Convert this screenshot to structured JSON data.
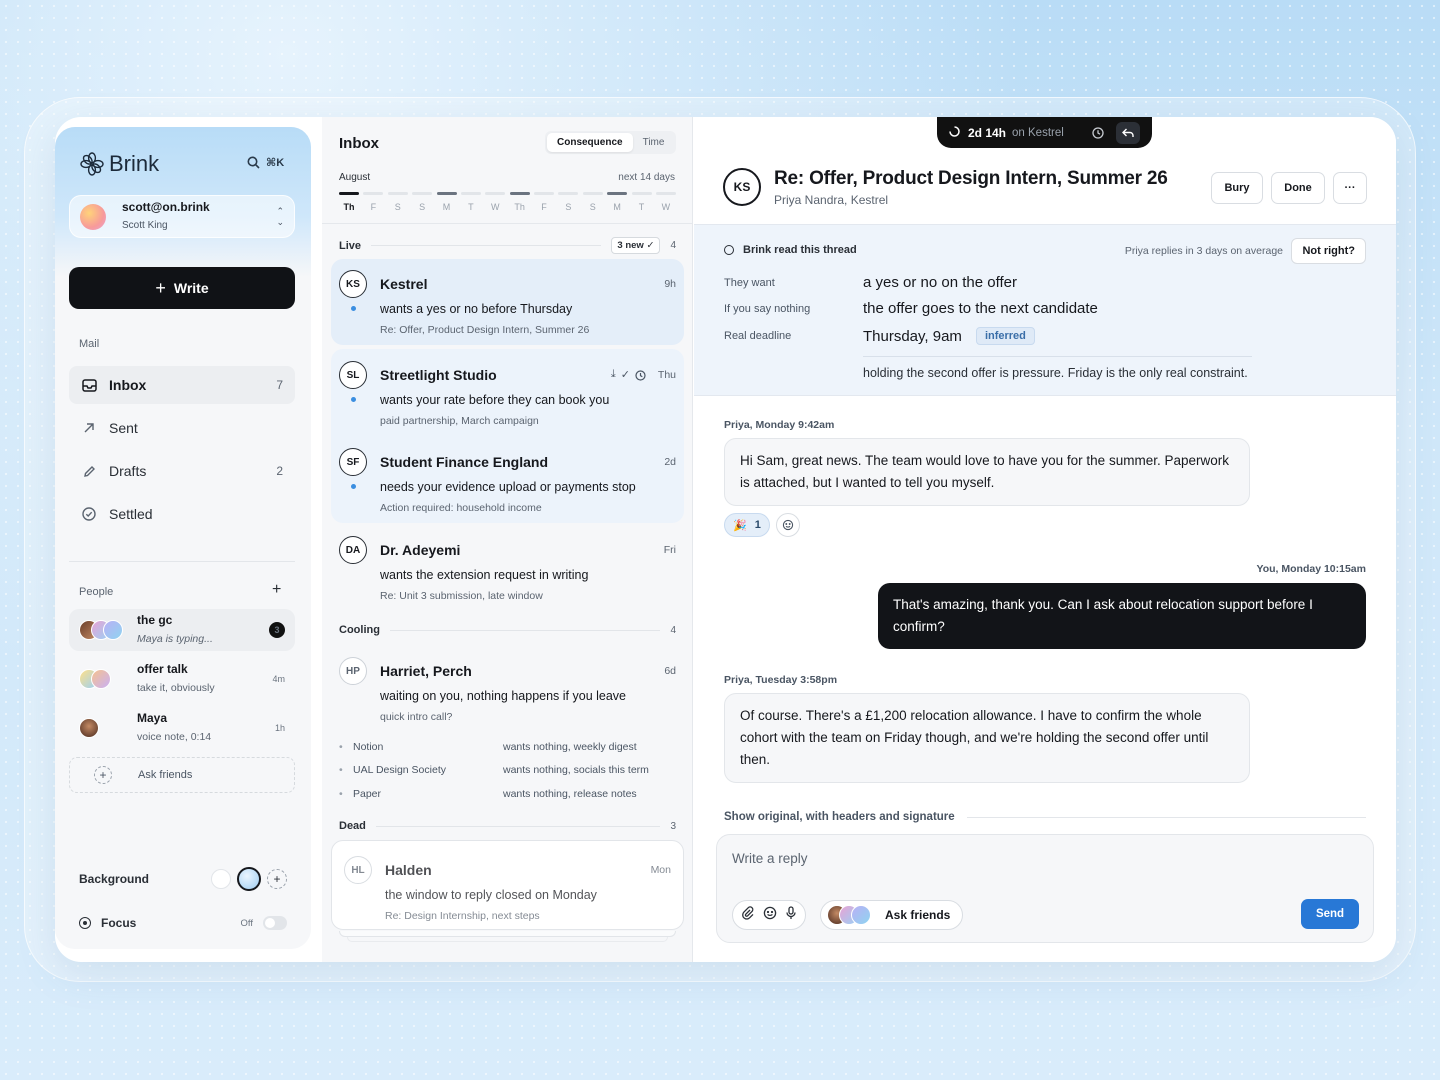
{
  "brand": {
    "name": "Brink",
    "search_shortcut": "⌘K"
  },
  "account": {
    "email": "scott@on.brink",
    "name": "Scott King"
  },
  "write_label": "Write",
  "mail_section": "Mail",
  "nav": [
    {
      "label": "Inbox",
      "count": "7"
    },
    {
      "label": "Sent",
      "count": ""
    },
    {
      "label": "Drafts",
      "count": "2"
    },
    {
      "label": "Settled",
      "count": ""
    }
  ],
  "people_section": "People",
  "people": [
    {
      "name": "the gc",
      "status": "Maya is typing...",
      "badge": "3"
    },
    {
      "name": "offer talk",
      "status": "take it, obviously",
      "time": "4m"
    },
    {
      "name": "Maya",
      "status": "voice note, 0:14",
      "time": "1h"
    }
  ],
  "ask_friends": "Ask friends",
  "background_label": "Background",
  "focus": {
    "label": "Focus",
    "state": "Off"
  },
  "inbox": {
    "title": "Inbox",
    "sort_options": [
      "Consequence",
      "Time"
    ],
    "sort_selected": "Consequence",
    "month": "August",
    "range": "next 14 days",
    "days": [
      "Th",
      "F",
      "S",
      "S",
      "M",
      "T",
      "W",
      "Th",
      "F",
      "S",
      "S",
      "M",
      "T",
      "W"
    ]
  },
  "groups": {
    "live": {
      "label": "Live",
      "new_badge": "3 new",
      "count": "4"
    },
    "cooling": {
      "label": "Cooling",
      "count": "4"
    },
    "dead": {
      "label": "Dead",
      "count": "3"
    }
  },
  "messages": [
    {
      "mono": "KS",
      "from": "Kestrel",
      "time": "9h",
      "summary": "wants a yes or no before Thursday",
      "subject": "Re: Offer, Product Design Intern, Summer 26"
    },
    {
      "mono": "SL",
      "from": "Streetlight Studio",
      "time": "Thu",
      "summary": "wants your rate before they can book you",
      "subject": "paid partnership, March campaign"
    },
    {
      "mono": "SF",
      "from": "Student Finance England",
      "time": "2d",
      "summary": "needs your evidence upload or payments stop",
      "subject": "Action required: household income"
    },
    {
      "mono": "DA",
      "from": "Dr. Adeyemi",
      "time": "Fri",
      "summary": "wants the extension request in writing",
      "subject": "Re: Unit 3 submission, late window"
    },
    {
      "mono": "HP",
      "from": "Harriet, Perch",
      "time": "6d",
      "summary": "waiting on you, nothing happens if you leave",
      "subject": "quick intro call?"
    },
    {
      "mono": "HL",
      "from": "Halden",
      "time": "Mon",
      "summary": "the window to reply closed on Monday",
      "subject": "Re: Design Internship, next steps"
    }
  ],
  "low_items": [
    {
      "name": "Notion",
      "note": "wants nothing, weekly digest"
    },
    {
      "name": "UAL Design Society",
      "note": "wants nothing, socials this term"
    },
    {
      "name": "Paper",
      "note": "wants nothing, release notes"
    }
  ],
  "timer": {
    "value": "2d 14h",
    "on": "on Kestrel"
  },
  "thread": {
    "mono": "KS",
    "title": "Re: Offer, Product Design Intern, Summer 26",
    "participants": "Priya Nandra, Kestrel",
    "actions": [
      "Bury",
      "Done",
      "···"
    ]
  },
  "brief": {
    "status": "Brink read this thread",
    "avg": "Priya replies in 3 days on average",
    "not_right": "Not right?",
    "rows": [
      {
        "k": "They want",
        "v": "a yes or no on the offer"
      },
      {
        "k": "If you say nothing",
        "v": "the offer goes to the next candidate"
      },
      {
        "k": "Real deadline",
        "v": "Thursday, 9am",
        "tag": "inferred"
      }
    ],
    "note": "holding the second offer is pressure. Friday is the only real constraint."
  },
  "conversation": [
    {
      "meta": "Priya, Monday 9:42am",
      "text": "Hi Sam, great news. The team would love to have you for the summer. Paperwork is attached, but I wanted to tell you myself."
    },
    {
      "meta": "You, Monday 10:15am",
      "text": "That's amazing, thank you. Can I ask about relocation support before I confirm?"
    },
    {
      "meta": "Priya, Tuesday 3:58pm",
      "text": "Of course. There's a £1,200 relocation allowance. I have to confirm the whole cohort with the team on Friday though, and we're holding the second offer until then."
    }
  ],
  "reaction": {
    "emoji": "🎉",
    "count": "1"
  },
  "show_original": "Show original, with headers and signature",
  "composer": {
    "placeholder": "Write a reply",
    "ask_friends": "Ask friends",
    "send": "Send"
  }
}
